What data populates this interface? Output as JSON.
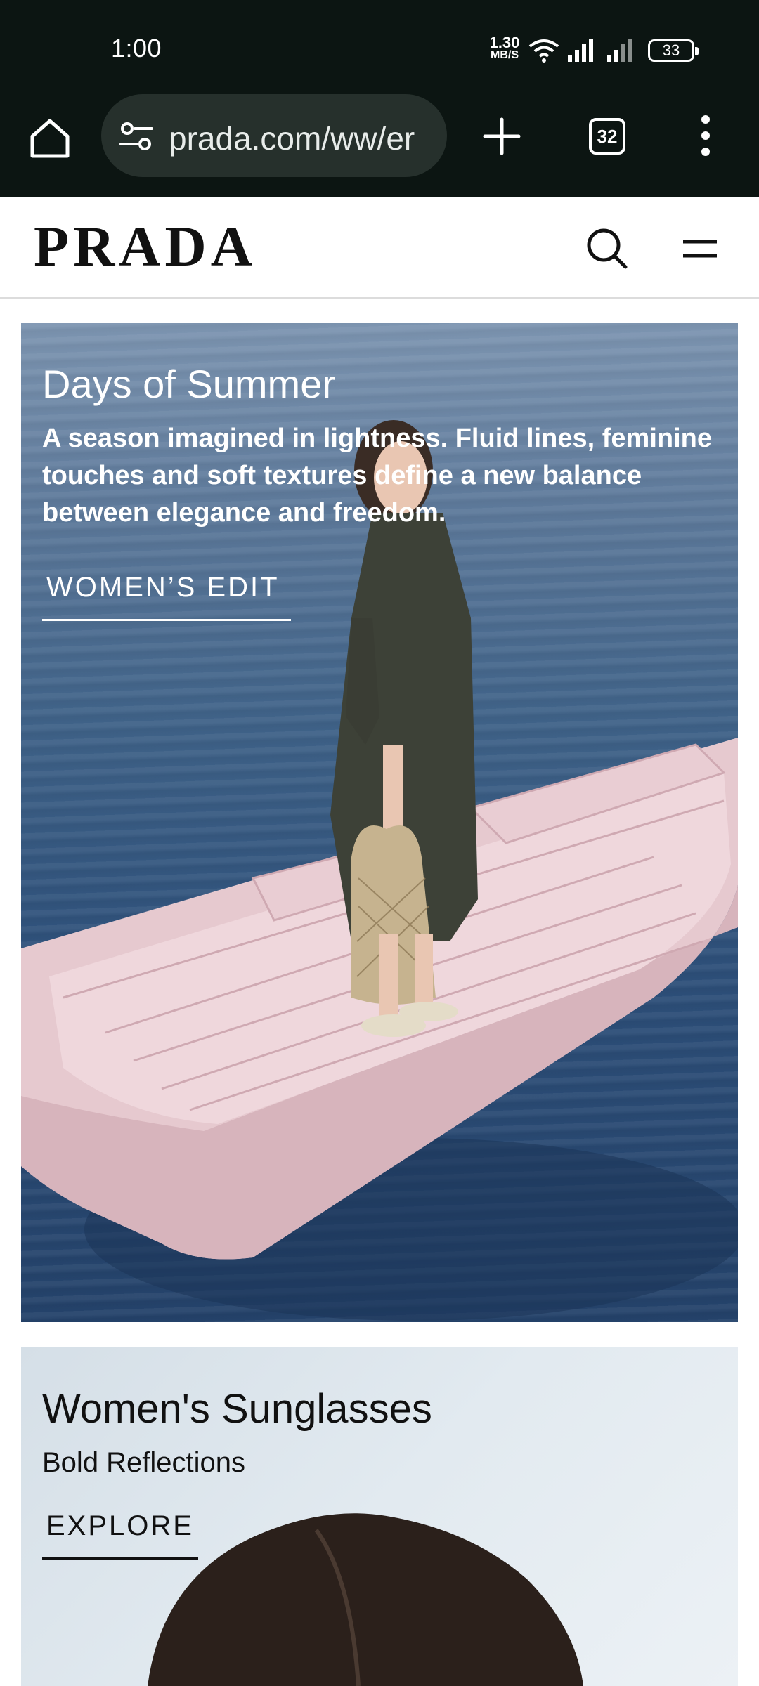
{
  "status_bar": {
    "time": "1:00",
    "net_speed_value": "1.30",
    "net_speed_unit": "MB/S",
    "battery": "33"
  },
  "browser": {
    "url": "prada.com/ww/er",
    "tab_count": "32",
    "icons": {
      "home": "home-icon",
      "site_settings": "tune-icon",
      "new_tab": "plus-icon",
      "tabs": "tabs-icon",
      "menu": "more-vert-icon"
    }
  },
  "site_header": {
    "logo": "PRADA",
    "icons": {
      "search": "search-icon",
      "menu": "menu-icon"
    }
  },
  "hero": {
    "title": "Days of Summer",
    "description": "A season imagined in lightness. Fluid lines, feminine touches and soft textures define a new balance between elegance and freedom.",
    "cta": "WOMEN’S EDIT"
  },
  "promo": {
    "title": "Women's Sunglasses",
    "subtitle": "Bold Reflections",
    "cta": "EXPLORE"
  },
  "colors": {
    "browser_bar": "#0c1512",
    "url_pill": "#26302c",
    "boat_pink": "#e6c9cf",
    "water_blue": "#2d4f79"
  }
}
